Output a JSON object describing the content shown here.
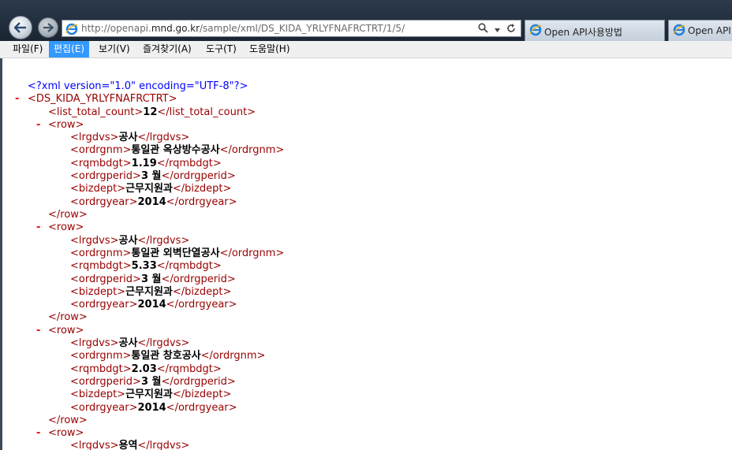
{
  "browser": {
    "address_url_prefix": "http://openapi.",
    "address_url_domain": "mnd.go.kr",
    "address_url_suffix": "/sample/xml/DS_KIDA_YRLYFNAFRCTRT/1/5/",
    "tab1_label": "Open API사용방법",
    "tab2_label": "Open API"
  },
  "menu": {
    "file": "파일(F)",
    "edit": "편집(E)",
    "view": "보기(V)",
    "favorites": "즐겨찾기(A)",
    "tools": "도구(T)",
    "help": "도움말(H)"
  },
  "xml": {
    "declaration": "<?xml version=\"1.0\" encoding=\"UTF-8\"?>",
    "root_open": "<DS_KIDA_YRLYFNAFRCTRT>",
    "total_open": "<list_total_count>",
    "total_value": "12",
    "total_close": "</list_total_count>",
    "row_open": "<row>",
    "row_close": "</row>",
    "minus": "-",
    "rows": [
      {
        "lrgdvs": "공사",
        "ordrgnm": "통일관 옥상방수공사",
        "rqmbdgt": "1.19",
        "ordrgperid": "3 월",
        "bizdept": "근무지원과",
        "ordrgyear": "2014"
      },
      {
        "lrgdvs": "공사",
        "ordrgnm": "통일관 외벽단열공사",
        "rqmbdgt": "5.33",
        "ordrgperid": "3 월",
        "bizdept": "근무지원과",
        "ordrgyear": "2014"
      },
      {
        "lrgdvs": "공사",
        "ordrgnm": "통일관 창호공사",
        "rqmbdgt": "2.03",
        "ordrgperid": "3 월",
        "bizdept": "근무지원과",
        "ordrgyear": "2014"
      },
      {
        "lrgdvs": "용역"
      }
    ],
    "fields": [
      "lrgdvs",
      "ordrgnm",
      "rqmbdgt",
      "ordrgperid",
      "bizdept",
      "ordrgyear"
    ]
  }
}
